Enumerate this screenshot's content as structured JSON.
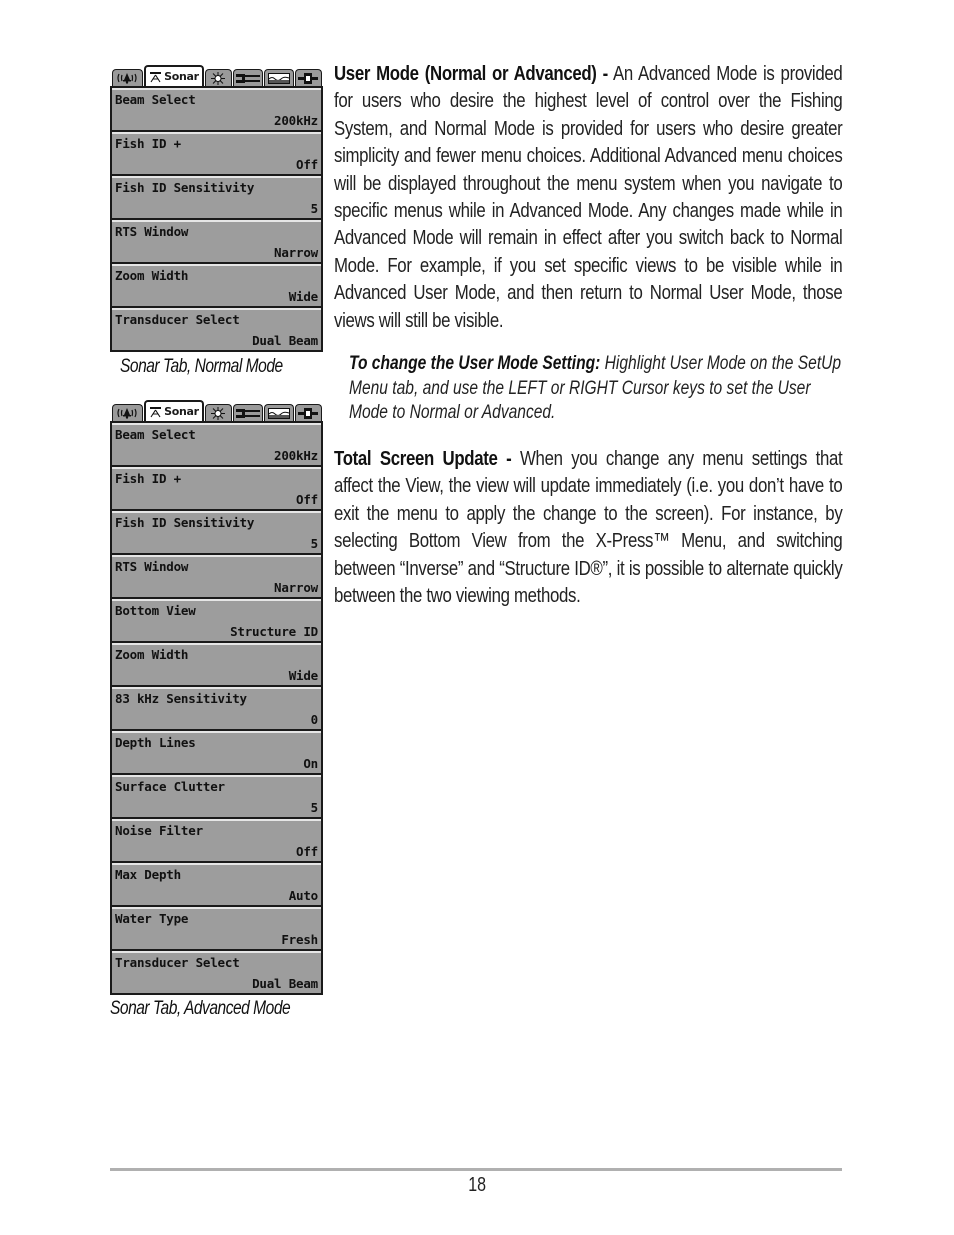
{
  "menus": {
    "tabs": [
      {
        "icon": "alarm-bell-icon",
        "label": ""
      },
      {
        "icon": "sonar-icon",
        "label": "Sonar",
        "active": true
      },
      {
        "icon": "navigation-light-icon",
        "label": ""
      },
      {
        "icon": "setup-wrench-icon",
        "label": ""
      },
      {
        "icon": "views-icon",
        "label": ""
      },
      {
        "icon": "accessories-plug-icon",
        "label": ""
      }
    ],
    "normal": {
      "caption": "Sonar Tab, Normal Mode",
      "rows": [
        {
          "label": "Beam Select",
          "value": "200kHz"
        },
        {
          "label": "Fish ID +",
          "value": "Off"
        },
        {
          "label": "Fish ID Sensitivity",
          "value": "5"
        },
        {
          "label": "RTS Window",
          "value": "Narrow"
        },
        {
          "label": "Zoom Width",
          "value": "Wide"
        },
        {
          "label": "Transducer Select",
          "value": "Dual Beam"
        }
      ]
    },
    "advanced": {
      "caption": "Sonar Tab, Advanced Mode",
      "rows": [
        {
          "label": "Beam Select",
          "value": "200kHz"
        },
        {
          "label": "Fish ID +",
          "value": "Off"
        },
        {
          "label": "Fish ID Sensitivity",
          "value": "5"
        },
        {
          "label": "RTS Window",
          "value": "Narrow"
        },
        {
          "label": "Bottom View",
          "value": "Structure ID"
        },
        {
          "label": "Zoom Width",
          "value": "Wide"
        },
        {
          "label": "83 kHz Sensitivity",
          "value": "0"
        },
        {
          "label": "Depth Lines",
          "value": "On"
        },
        {
          "label": "Surface Clutter",
          "value": "5"
        },
        {
          "label": "Noise Filter",
          "value": "Off"
        },
        {
          "label": "Max Depth",
          "value": "Auto"
        },
        {
          "label": "Water Type",
          "value": "Fresh"
        },
        {
          "label": "Transducer Select",
          "value": "Dual Beam"
        }
      ]
    }
  },
  "content": {
    "user_mode": {
      "heading": "User Mode (Normal or Advanced) -",
      "body": " An Advanced Mode is provided for users who desire the highest level of control over the Fishing System, and Normal Mode is provided for users who desire greater simplicity and fewer menu choices. Additional Advanced menu choices will be displayed throughout the menu system when you navigate to specific menus while in Advanced Mode. Any changes made while in Advanced Mode will remain in effect after you switch back to Normal Mode. For example, if you set specific views to be visible while in Advanced User Mode, and then return to Normal User Mode, those views will still be visible."
    },
    "note": {
      "heading": "To change the User Mode Setting:",
      "body": " Highlight User Mode on the SetUp Menu tab, and use the LEFT or RIGHT Cursor keys to set the User Mode to Normal or Advanced."
    },
    "screen_update": {
      "heading": "Total Screen Update -",
      "body": " When you change any menu settings that affect the View, the view will update immediately (i.e. you don’t have to exit the menu to apply the change to the screen). For instance, by selecting Bottom View from the X-Press™ Menu, and switching between “Inverse” and “Structure ID®”, it is possible to alternate quickly between the two viewing methods."
    }
  },
  "footer": {
    "page_number": "18"
  }
}
